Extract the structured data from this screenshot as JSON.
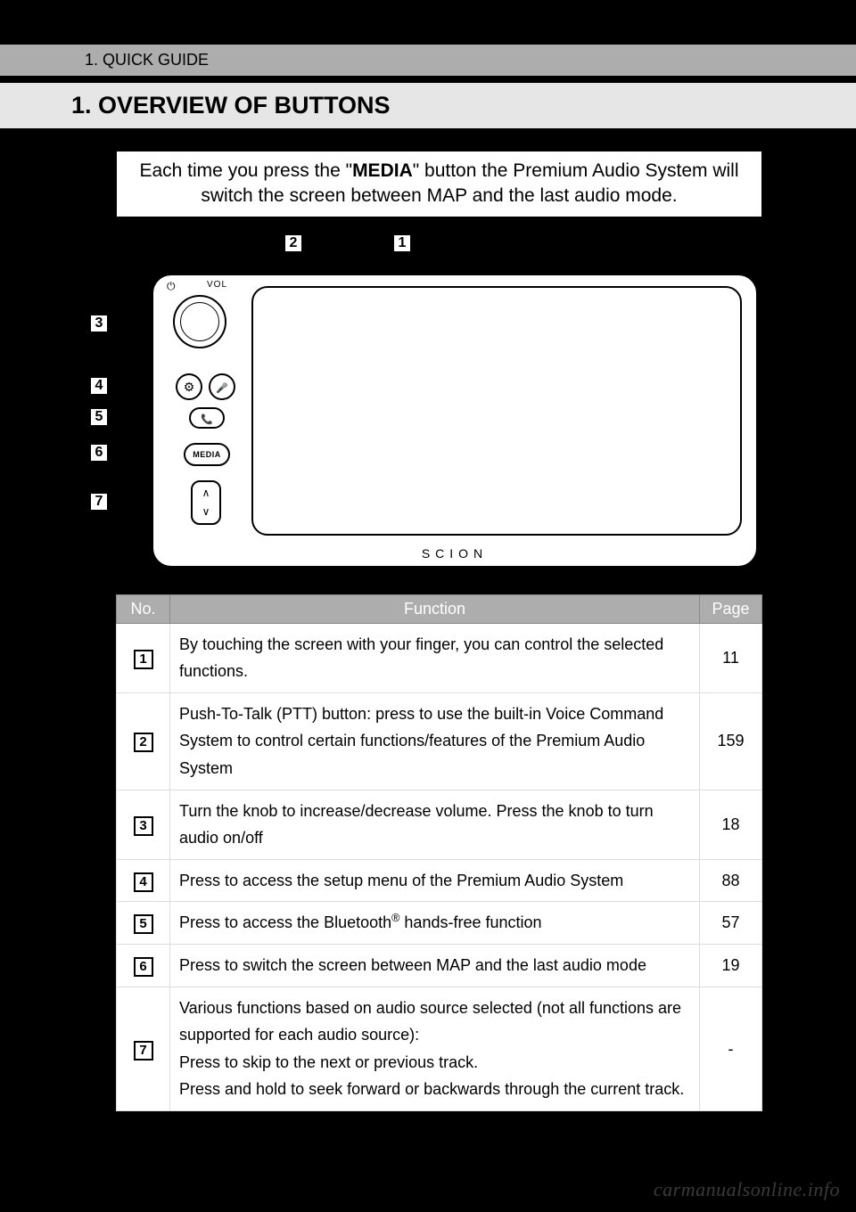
{
  "header": {
    "section": "1. QUICK GUIDE",
    "title": "1. OVERVIEW OF BUTTONS"
  },
  "info_box": {
    "prefix": "Each time you press the \"",
    "bold": "MEDIA",
    "suffix": "\" button the Premium Audio System will switch the screen between MAP and the last audio mode."
  },
  "callouts_top": [
    "2",
    "1"
  ],
  "callouts_left": [
    "3",
    "4",
    "5",
    "6",
    "7"
  ],
  "device": {
    "power_symbol": "⏻",
    "vol_label": "VOL",
    "gear_symbol": "⚙",
    "ptt_symbol": "🎤",
    "phone_symbol": "📞",
    "media_label": "MEDIA",
    "up_symbol": "∧",
    "down_symbol": "∨",
    "brand": "SCION"
  },
  "table": {
    "headers": {
      "no": "No.",
      "function": "Function",
      "page": "Page"
    },
    "rows": [
      {
        "no": "1",
        "function": "By touching the screen with your finger, you can control the selected functions.",
        "page": "11"
      },
      {
        "no": "2",
        "function": "Push-To-Talk (PTT) button: press to use the built-in Voice Command System to control certain functions/features of the Premium Audio System",
        "page": "159"
      },
      {
        "no": "3",
        "function": "Turn the knob to increase/decrease volume. Press the knob to turn audio on/off",
        "page": "18"
      },
      {
        "no": "4",
        "function": "Press to access the setup menu of the Premium Audio System",
        "page": "88"
      },
      {
        "no": "5",
        "function_html": "Press to access the Bluetooth® hands-free function",
        "page": "57"
      },
      {
        "no": "6",
        "function": "Press to switch the screen between MAP and the last audio mode",
        "page": "19"
      },
      {
        "no": "7",
        "function_html": "Various functions based on audio source selected (not all functions are supported for each audio source):<br>Press to skip to the next or previous track.<br>Press and hold to seek forward or backwards through the current track.",
        "page": "-"
      }
    ]
  },
  "watermark": "carmanualsonline.info"
}
